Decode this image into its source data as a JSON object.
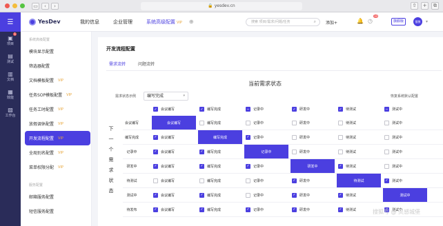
{
  "browser": {
    "url": "yesdev.cn"
  },
  "app": {
    "logo": "YesDev"
  },
  "rail": {
    "items": [
      {
        "label": "项目",
        "icon": "box-icon",
        "badge": "1"
      },
      {
        "label": "测试",
        "icon": "test-icon",
        "badge": ""
      },
      {
        "label": "文档",
        "icon": "doc-icon",
        "badge": ""
      },
      {
        "label": "效能",
        "icon": "chart-icon",
        "badge": ""
      },
      {
        "label": "工作台",
        "icon": "desk-icon",
        "badge": ""
      }
    ]
  },
  "topnav": {
    "menu": [
      "我的信息",
      "企业管理",
      "系统高级配置"
    ],
    "vip": "VIP",
    "search_placeholder": "搜索 项目/需求/问题/任务",
    "add": "添加+",
    "clock_badge": "10",
    "user_badge": "旗舰版",
    "avatar": "银狼"
  },
  "sidebar": {
    "group1": "系统高级配置",
    "items": [
      {
        "label": "模块显示配置",
        "vip": ""
      },
      {
        "label": "筛选器配置",
        "vip": ""
      },
      {
        "label": "文档模板配置",
        "vip": "VIP"
      },
      {
        "label": "任务SOP模板配置",
        "vip": "VIP"
      },
      {
        "label": "任务工时配置",
        "vip": "VIP"
      },
      {
        "label": "放假调休配置",
        "vip": "VIP"
      },
      {
        "label": "开发流程配置",
        "vip": "VIP"
      },
      {
        "label": "全局别名配置",
        "vip": "VIP"
      },
      {
        "label": "菜单权限分配",
        "vip": "VIP"
      }
    ],
    "group2": "服务配置",
    "items2": [
      {
        "label": "邮箱服务配置"
      },
      {
        "label": "短信服务配置"
      }
    ]
  },
  "main": {
    "title": "开发流程配置",
    "tabs": [
      "需求流转",
      "问题流转"
    ],
    "state_title": "当前需求状态",
    "example_label": "需求状态示例",
    "example_value": "编写完成",
    "restore": "恢复系统默认配置",
    "next_label": [
      "下",
      "一",
      "个",
      "需",
      "求",
      "状",
      "态"
    ]
  },
  "matrix": {
    "columns": [
      "会议编写",
      "编写完成",
      "记录中",
      "研发中",
      "待测试",
      "测试中"
    ],
    "rows": [
      "会议编写",
      "编写完成",
      "记录中",
      "研发中",
      "待测试",
      "测试中",
      "待发布"
    ],
    "header_checks": [
      "on",
      "on",
      "partial",
      "on",
      "on",
      "partial"
    ],
    "cells": [
      [
        "diag",
        "off",
        "off",
        "off",
        "off",
        "off"
      ],
      [
        "on",
        "diag",
        "on",
        "off",
        "off",
        "off"
      ],
      [
        "on",
        "on",
        "diag",
        "off",
        "off",
        "off"
      ],
      [
        "on",
        "on",
        "on",
        "diag",
        "on",
        "off"
      ],
      [
        "off",
        "off",
        "off",
        "on",
        "diag",
        "on"
      ],
      [
        "on",
        "on",
        "off",
        "on",
        "on",
        "diag"
      ],
      [
        "on",
        "on",
        "on",
        "on",
        "on",
        "on"
      ]
    ]
  },
  "watermark": "搜狐号 @ 灵感城堡",
  "colors": {
    "accent": "#4b3fe0",
    "rail": "#2a2c59",
    "vip": "#e7a53b"
  }
}
